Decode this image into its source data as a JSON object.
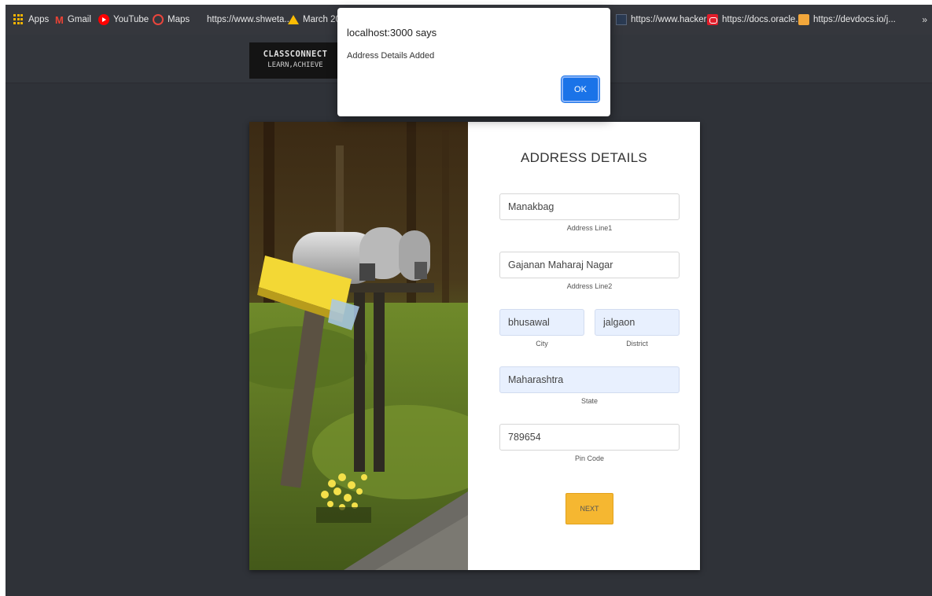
{
  "bookmarks": {
    "items": [
      {
        "label": "Apps",
        "icon": "apps-grid-icon"
      },
      {
        "label": "Gmail",
        "icon": "gmail-icon"
      },
      {
        "label": "YouTube",
        "icon": "youtube-icon"
      },
      {
        "label": "Maps",
        "icon": "maps-icon"
      },
      {
        "label": "https://www.shweta...",
        "icon": ""
      },
      {
        "label": "March 202",
        "icon": "google-drive-icon"
      },
      {
        "label": "https://www.hacker...",
        "icon": "hackerrank-icon"
      },
      {
        "label": "https://docs.oracle....",
        "icon": "oracle-icon"
      },
      {
        "label": "https://devdocs.io/j...",
        "icon": "devdocs-icon"
      }
    ],
    "overflow": "»"
  },
  "header": {
    "logo_title": "CLASSCONNECT",
    "logo_subtitle": "LEARN,ACHIEVE"
  },
  "form": {
    "title": "ADDRESS DETAILS",
    "address1": {
      "value": "Manakbag",
      "label": "Address Line1"
    },
    "address2": {
      "value": "Gajanan Maharaj Nagar",
      "label": "Address Line2"
    },
    "city": {
      "value": "bhusawal",
      "label": "City"
    },
    "district": {
      "value": "jalgaon",
      "label": "District"
    },
    "state": {
      "value": "Maharashtra",
      "label": "State"
    },
    "pincode": {
      "value": "789654",
      "label": "Pin Code"
    },
    "next_label": "NEXT"
  },
  "dialog": {
    "title": "localhost:3000 says",
    "message": "Address Details Added",
    "ok_label": "OK"
  },
  "colors": {
    "page_bg": "#2f3238",
    "accent_button": "#f5b731",
    "autofill_bg": "#e8f0fe",
    "dialog_ok": "#1a73e8"
  }
}
